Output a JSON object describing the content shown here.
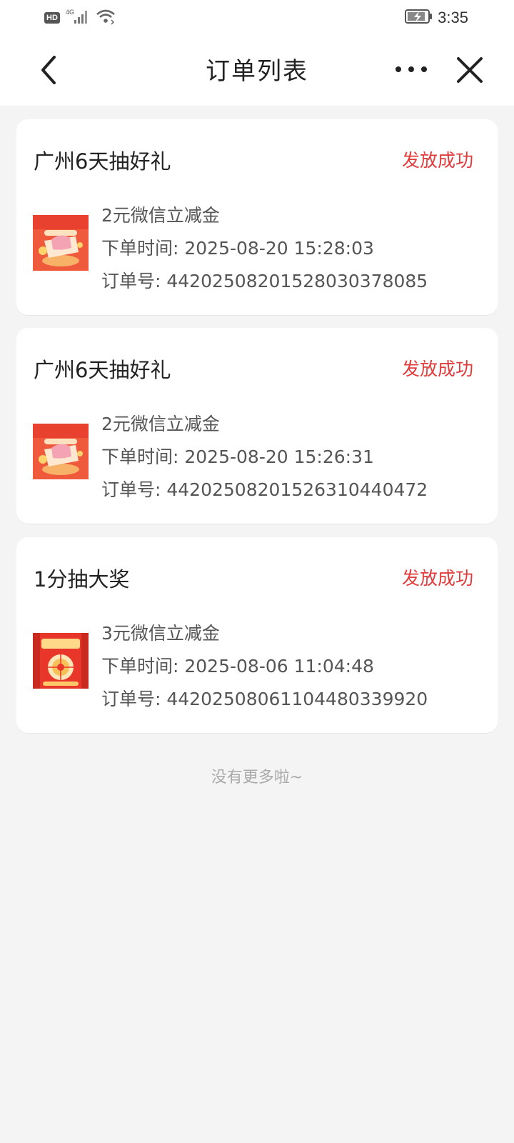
{
  "status_bar": {
    "hd": "HD",
    "network": "4G",
    "time": "3:35"
  },
  "nav": {
    "title": "订单列表"
  },
  "orders": [
    {
      "title": "广州6天抽好礼",
      "status": "发放成功",
      "item": "2元微信立减金",
      "time_line": "下单时间: 2025-08-20 15:28:03",
      "order_line": "订单号: 4420250820152803037808​5",
      "thumb": "customer-gift-thumbnail"
    },
    {
      "title": "广州6天抽好礼",
      "status": "发放成功",
      "item": "2元微信立减金",
      "time_line": "下单时间: 2025-08-20 15:26:31",
      "order_line": "订单号: 44202508201526310440472",
      "thumb": "customer-gift-thumbnail"
    },
    {
      "title": "1分抽大奖",
      "status": "发放成功",
      "item": "3元微信立减金",
      "time_line": "下单时间: 2025-08-06 11:04:48",
      "order_line": "订单号: 44202508061104480339920",
      "thumb": "lucky-draw-thumbnail"
    }
  ],
  "footer": {
    "no_more": "没有更多啦~"
  },
  "colors": {
    "status_success": "#e23b3b",
    "background": "#f4f4f4"
  }
}
